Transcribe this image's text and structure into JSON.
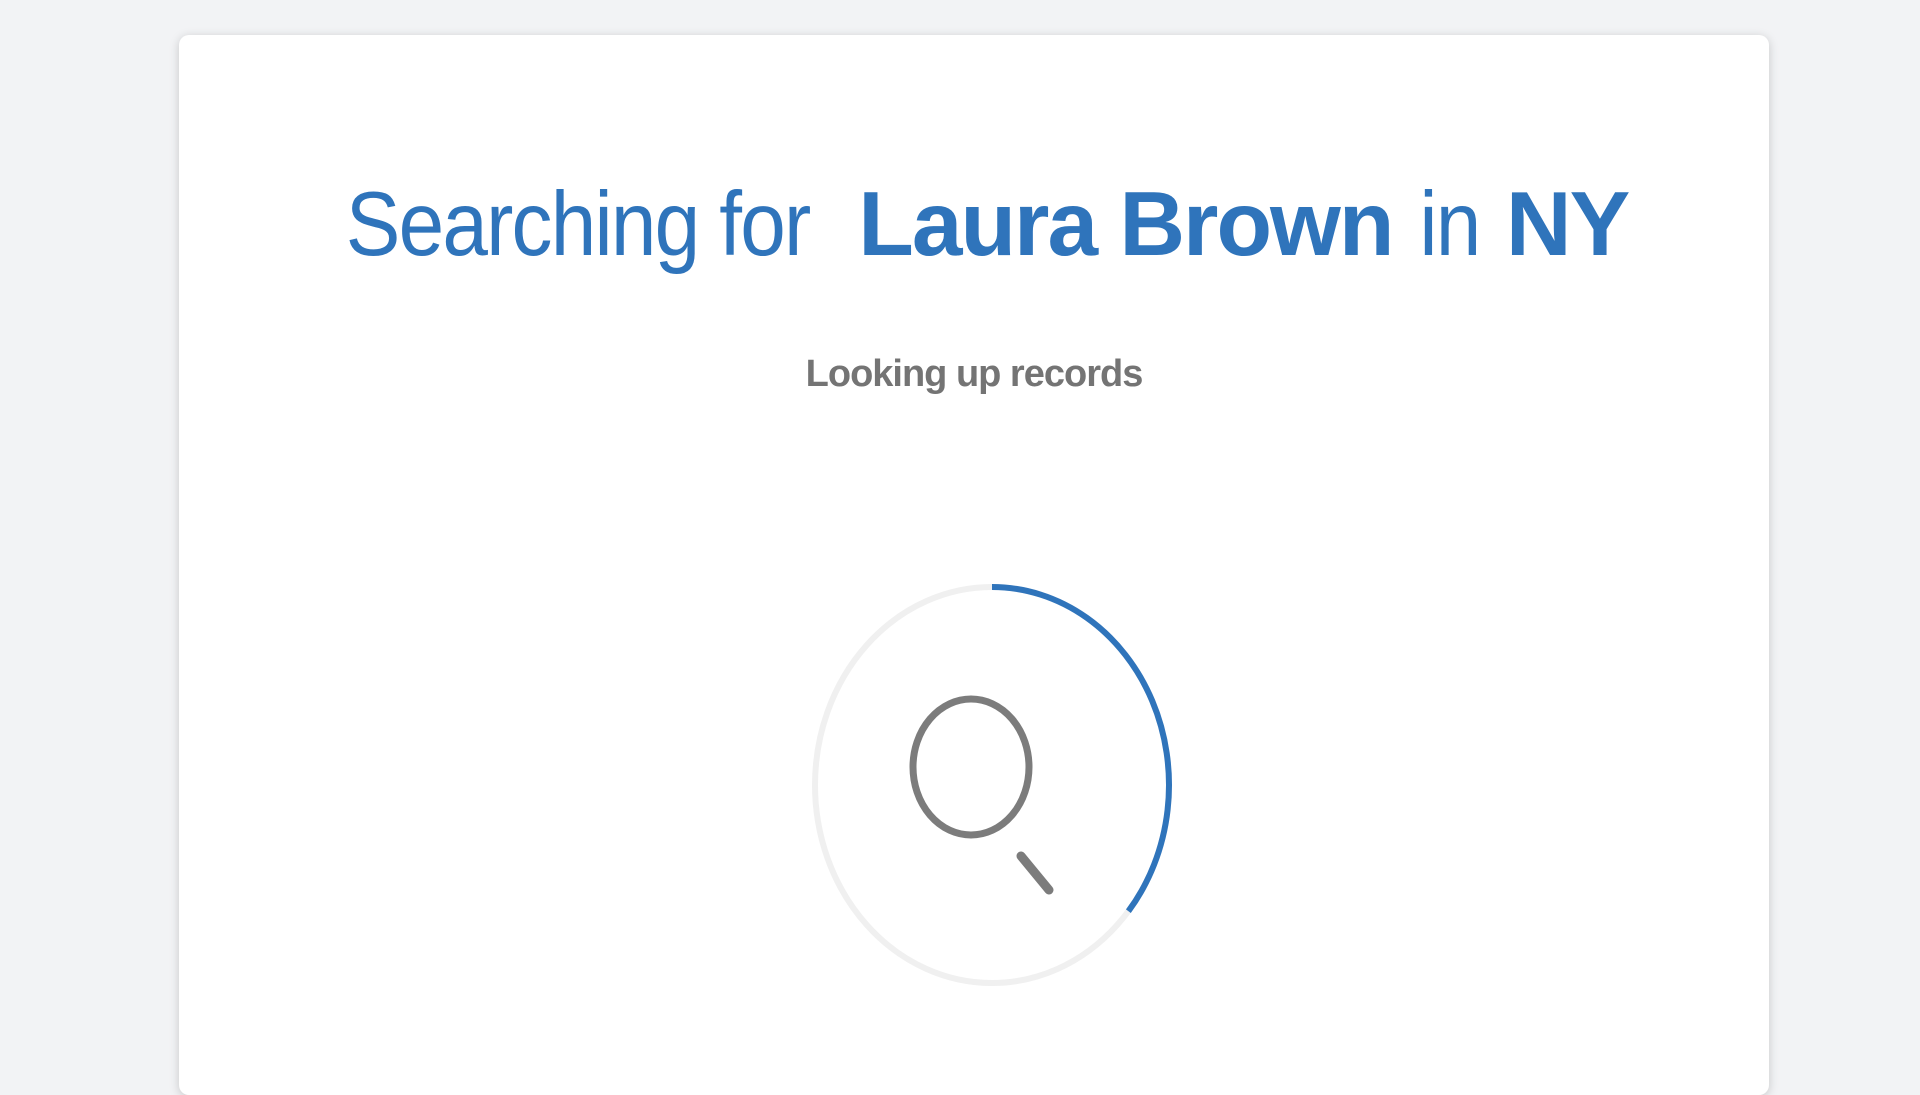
{
  "search": {
    "prefix": "Searching for",
    "name": "Laura Brown",
    "connector": "in",
    "location": "NY"
  },
  "status": {
    "text": "Looking up records",
    "progress_fraction": 0.36
  },
  "icons": {
    "center": "search-icon"
  },
  "colors": {
    "accent": "#2f74bb",
    "muted_text": "#747474",
    "track": "#f0f0f0",
    "icon": "#7c7c7c",
    "background": "#f2f3f5",
    "card": "#ffffff"
  }
}
